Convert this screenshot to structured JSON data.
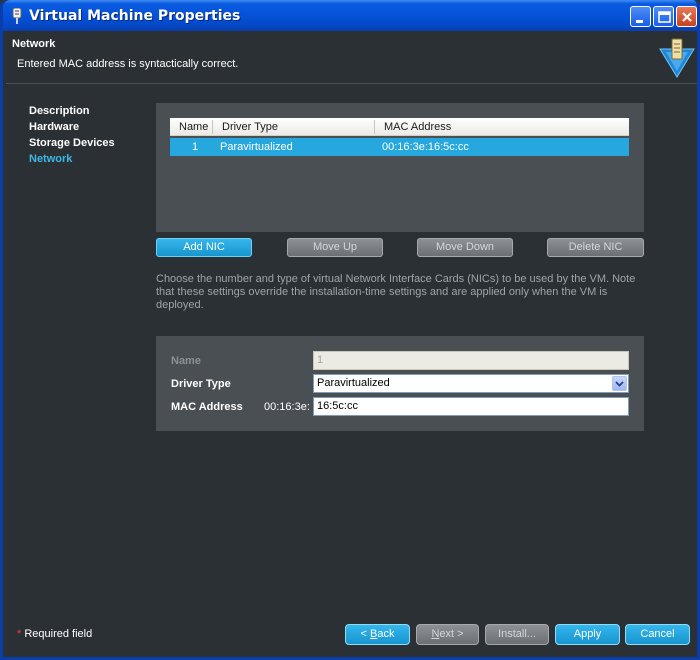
{
  "window": {
    "title": "Virtual Machine Properties"
  },
  "header": {
    "title": "Network",
    "message": "Entered MAC address is syntactically correct."
  },
  "nav": {
    "items": [
      {
        "label": "Description"
      },
      {
        "label": "Hardware"
      },
      {
        "label": "Storage Devices"
      },
      {
        "label": "Network",
        "active": true
      }
    ]
  },
  "nic_table": {
    "columns": [
      "Name",
      "Driver Type",
      "MAC Address"
    ],
    "rows": [
      {
        "name": "1",
        "driver": "Paravirtualized",
        "mac": "00:16:3e:16:5c:cc"
      }
    ]
  },
  "nic_buttons": {
    "add": "Add NIC",
    "move_up": "Move Up",
    "move_down": "Move Down",
    "delete": "Delete NIC"
  },
  "description": "Choose the number and type of virtual Network Interface Cards (NICs) to be used by the VM. Note that these settings override the installation-time settings and are applied only when the VM is deployed.",
  "form": {
    "name_label": "Name",
    "name_value": "1",
    "driver_label": "Driver Type",
    "driver_value": "Paravirtualized",
    "mac_label": "MAC Address",
    "mac_prefix": "00:16:3e:",
    "mac_value": "16:5c:cc"
  },
  "footer": {
    "required_star": "*",
    "required_text": " Required field",
    "back_prefix": "< ",
    "back_mnemonic": "B",
    "back_rest": "ack",
    "next_mnemonic": "N",
    "next_rest": "ext >",
    "install": "Install...",
    "apply": "Apply",
    "cancel": "Cancel"
  },
  "colors": {
    "accent": "#26a7dd",
    "nav_active": "#3cb7e8",
    "titlebar": "#0552d8",
    "background": "#2b3034",
    "panel": "#4a4f53"
  }
}
